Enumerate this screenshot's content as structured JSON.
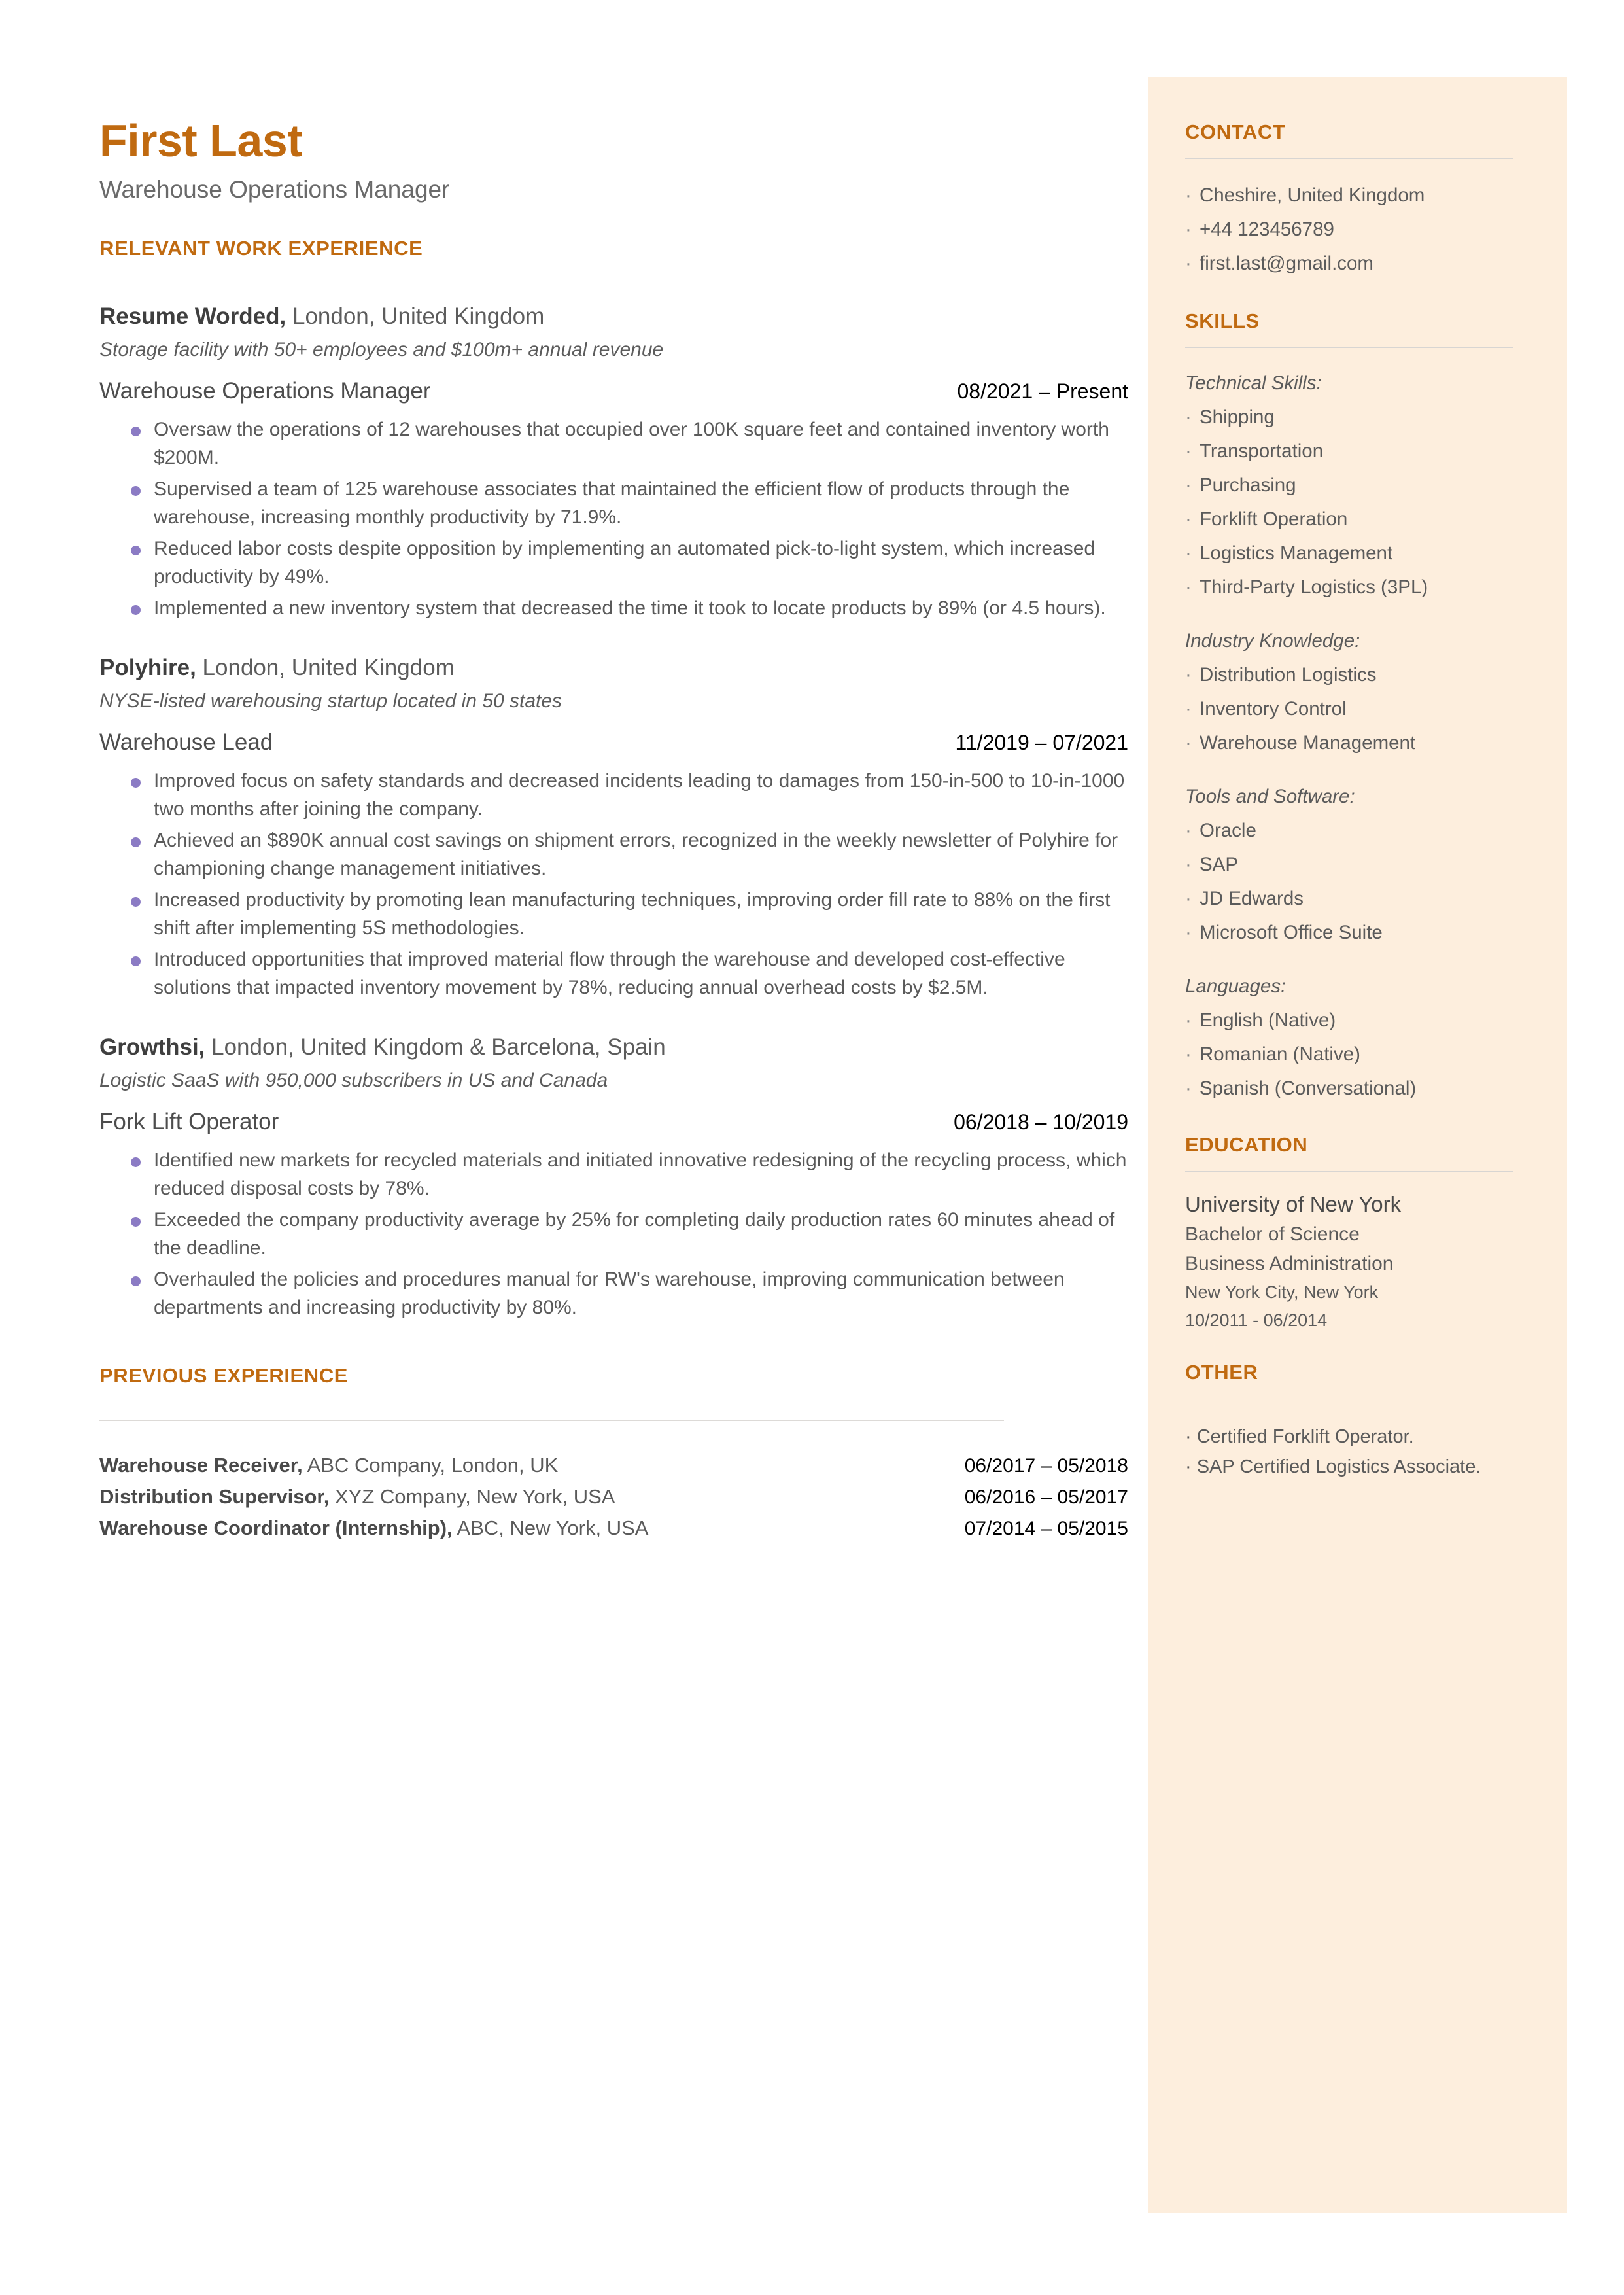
{
  "theme": {
    "accent": "#c06a10",
    "sidebar_bg": "#fdeedd",
    "bullet": "#8b7bc4",
    "body_text": "#5a5a5a"
  },
  "header": {
    "name": "First Last",
    "title": "Warehouse Operations Manager"
  },
  "main": {
    "relevant_heading": "RELEVANT WORK EXPERIENCE",
    "previous_heading": "PREVIOUS EXPERIENCE",
    "jobs": [
      {
        "company": "Resume Worded,",
        "location": " London, United Kingdom",
        "description": "Storage facility with 50+ employees and $100m+ annual revenue",
        "role": "Warehouse Operations Manager",
        "dates": "08/2021 – Present",
        "bullets": [
          "Oversaw the operations of 12 warehouses that occupied over 100K square feet and contained inventory worth $200M.",
          "Supervised a team of 125 warehouse associates that maintained the efficient flow of products through the warehouse, increasing monthly productivity by 71.9%.",
          "Reduced labor costs despite opposition by implementing an automated pick-to-light system, which increased productivity by 49%.",
          "Implemented a new inventory system that decreased the time it took to locate products by 89% (or 4.5 hours)."
        ]
      },
      {
        "company": "Polyhire,",
        "location": " London, United Kingdom",
        "description": "NYSE-listed warehousing startup located in 50 states",
        "role": "Warehouse Lead",
        "dates": "11/2019 – 07/2021",
        "bullets": [
          "Improved focus on safety standards and decreased incidents leading to damages from 150-in-500 to 10-in-1000 two months after joining the company.",
          "Achieved an $890K annual cost savings on shipment errors, recognized in the weekly newsletter of Polyhire for championing change management initiatives.",
          "Increased productivity by promoting lean manufacturing techniques, improving order fill rate to 88% on the first shift after implementing 5S methodologies.",
          "Introduced opportunities that improved material flow through the warehouse and developed cost-effective solutions that impacted inventory movement by 78%, reducing annual overhead costs by $2.5M."
        ]
      },
      {
        "company": "Growthsi,",
        "location": " London, United Kingdom & Barcelona, Spain",
        "description": "Logistic SaaS with 950,000 subscribers in US and Canada",
        "role": "Fork Lift Operator",
        "dates": "06/2018 – 10/2019",
        "bullets": [
          "Identified new markets for recycled materials and initiated innovative redesigning of the recycling process, which reduced disposal costs by 78%.",
          "Exceeded the company productivity average by 25% for completing daily production rates 60 minutes ahead of the deadline.",
          "Overhauled the policies and procedures manual for RW's warehouse, improving communication between departments and increasing productivity by 80%."
        ]
      }
    ],
    "previous_jobs": [
      {
        "role": "Warehouse Receiver,",
        "detail": " ABC Company, London, UK",
        "dates": "06/2017 – 05/2018"
      },
      {
        "role": "Distribution Supervisor,",
        "detail": " XYZ Company, New York, USA",
        "dates": "06/2016 – 05/2017"
      },
      {
        "role": "Warehouse Coordinator (Internship),",
        "detail": " ABC, New York, USA",
        "dates": "07/2014 – 05/2015"
      }
    ]
  },
  "sidebar": {
    "contact": {
      "heading": "CONTACT",
      "items": [
        "Cheshire, United Kingdom",
        "+44 123456789",
        "first.last@gmail.com"
      ]
    },
    "skills": {
      "heading": "SKILLS",
      "groups": [
        {
          "label": "Technical Skills:",
          "items": [
            "Shipping",
            "Transportation",
            "Purchasing",
            "Forklift Operation",
            "Logistics Management",
            "Third-Party Logistics (3PL)"
          ]
        },
        {
          "label": "Industry Knowledge:",
          "items": [
            "Distribution Logistics",
            "Inventory Control",
            "Warehouse Management"
          ]
        },
        {
          "label": "Tools and Software:",
          "items": [
            "Oracle",
            "SAP",
            "JD Edwards",
            "Microsoft Office Suite"
          ]
        },
        {
          "label": "Languages:",
          "items": [
            "English (Native)",
            "Romanian (Native)",
            "Spanish (Conversational)"
          ]
        }
      ]
    },
    "education": {
      "heading": "EDUCATION",
      "school": "University of New York",
      "degree": "Bachelor of Science",
      "field": "Business Administration",
      "location": "New York City, New York",
      "dates": "10/2011 - 06/2014"
    },
    "other": {
      "heading": "OTHER",
      "items": [
        "Certified Forklift Operator.",
        "SAP Certified Logistics Associate."
      ]
    }
  }
}
